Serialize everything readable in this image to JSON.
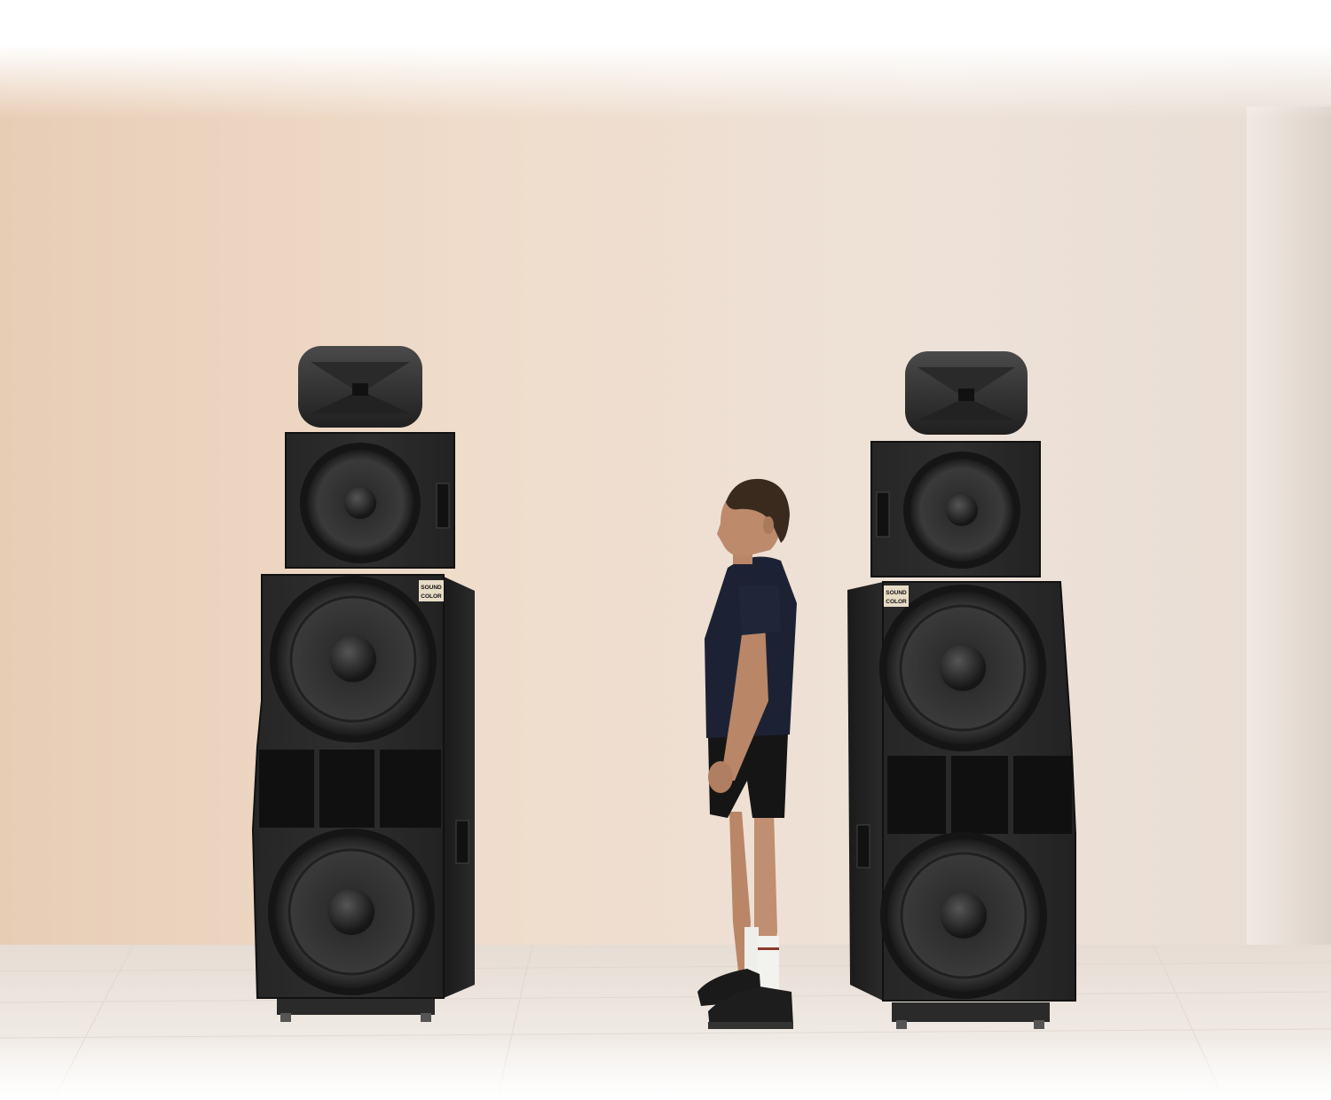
{
  "photo": {
    "subject": "person-standing-between-tall-speaker-stacks",
    "colors": {
      "wall_warm": "#e9d2bd",
      "wall_light": "#f3ebe4",
      "floor": "#efe9e4",
      "cabinet": "#232323",
      "cabinet_edge": "#3a3a3a",
      "driver_cone": "#2b2b2b",
      "shirt": "#1c2233",
      "shorts": "#151515",
      "skin": "#b98668",
      "hair": "#3a2a1e"
    }
  },
  "speaker_left": {
    "badge": {
      "line1": "SOUND",
      "line2": "COLOR"
    }
  },
  "speaker_right": {
    "badge": {
      "line1": "SOUND",
      "line2": "COLOR"
    }
  }
}
